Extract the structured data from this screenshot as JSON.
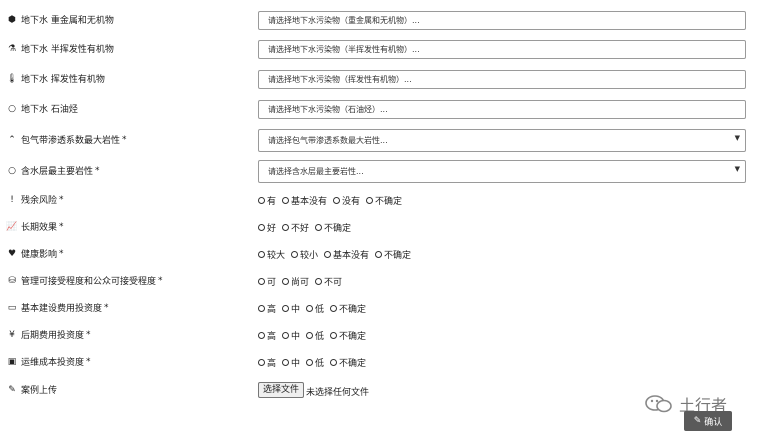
{
  "fields": [
    {
      "icon": "cube-icon",
      "glyph": "⬢",
      "label": "地下水 重金属和无机物",
      "placeholder": "请选择地下水污染物（重金属和无机物）..."
    },
    {
      "icon": "flask-icon",
      "glyph": "⚗",
      "label": "地下水 半挥发性有机物",
      "placeholder": "请选择地下水污染物（半挥发性有机物）..."
    },
    {
      "icon": "thermometer-icon",
      "glyph": "🌡",
      "label": "地下水 挥发性有机物",
      "placeholder": "请选择地下水污染物（挥发性有机物）..."
    },
    {
      "icon": "circle-icon",
      "glyph": "○",
      "label": "地下水 石油烃",
      "placeholder": "请选择地下水污染物（石油烃）..."
    }
  ],
  "selects": [
    {
      "icon": "chevron-up-icon",
      "glyph": "⌃",
      "label": "包气带渗透系数最大岩性",
      "required": "*",
      "value": "请选择包气带渗透系数最大岩性...",
      "caret": "▼"
    },
    {
      "icon": "circle-icon",
      "glyph": "○",
      "label": "含水层最主要岩性",
      "required": "*",
      "value": "请选择含水层最主要岩性...",
      "caret": "▼"
    }
  ],
  "radio_groups": [
    {
      "icon": "exclamation-icon",
      "glyph": "!",
      "label": "残余风险",
      "required": "*",
      "options": [
        "有",
        "基本没有",
        "没有",
        "不确定"
      ]
    },
    {
      "icon": "line-chart-icon",
      "glyph": "📈",
      "label": "长期效果",
      "required": "*",
      "options": [
        "好",
        "不好",
        "不确定"
      ]
    },
    {
      "icon": "heart-icon",
      "glyph": "♥",
      "label": "健康影响",
      "required": "*",
      "options": [
        "较大",
        "较小",
        "基本没有",
        "不确定"
      ]
    },
    {
      "icon": "database-icon",
      "glyph": "⛁",
      "label": "管理可接受程度和公众可接受程度",
      "required": "*",
      "options": [
        "可",
        "尚可",
        "不可"
      ]
    },
    {
      "icon": "credit-card-icon",
      "glyph": "▭",
      "label": "基本建设费用投资度",
      "required": "*",
      "options": [
        "高",
        "中",
        "低",
        "不确定"
      ]
    },
    {
      "icon": "yen-icon",
      "glyph": "¥",
      "label": "后期费用投资度",
      "required": "*",
      "options": [
        "高",
        "中",
        "低",
        "不确定"
      ]
    },
    {
      "icon": "money-icon",
      "glyph": "▣",
      "label": "运维成本投资度",
      "required": "*",
      "options": [
        "高",
        "中",
        "低",
        "不确定"
      ]
    }
  ],
  "upload": {
    "icon": "edit-icon",
    "glyph": "✎",
    "label": "案例上传",
    "button": "选择文件",
    "status": "未选择任何文件"
  },
  "watermark": "土行者",
  "confirm": {
    "glyph": "✎",
    "label": "确认"
  }
}
